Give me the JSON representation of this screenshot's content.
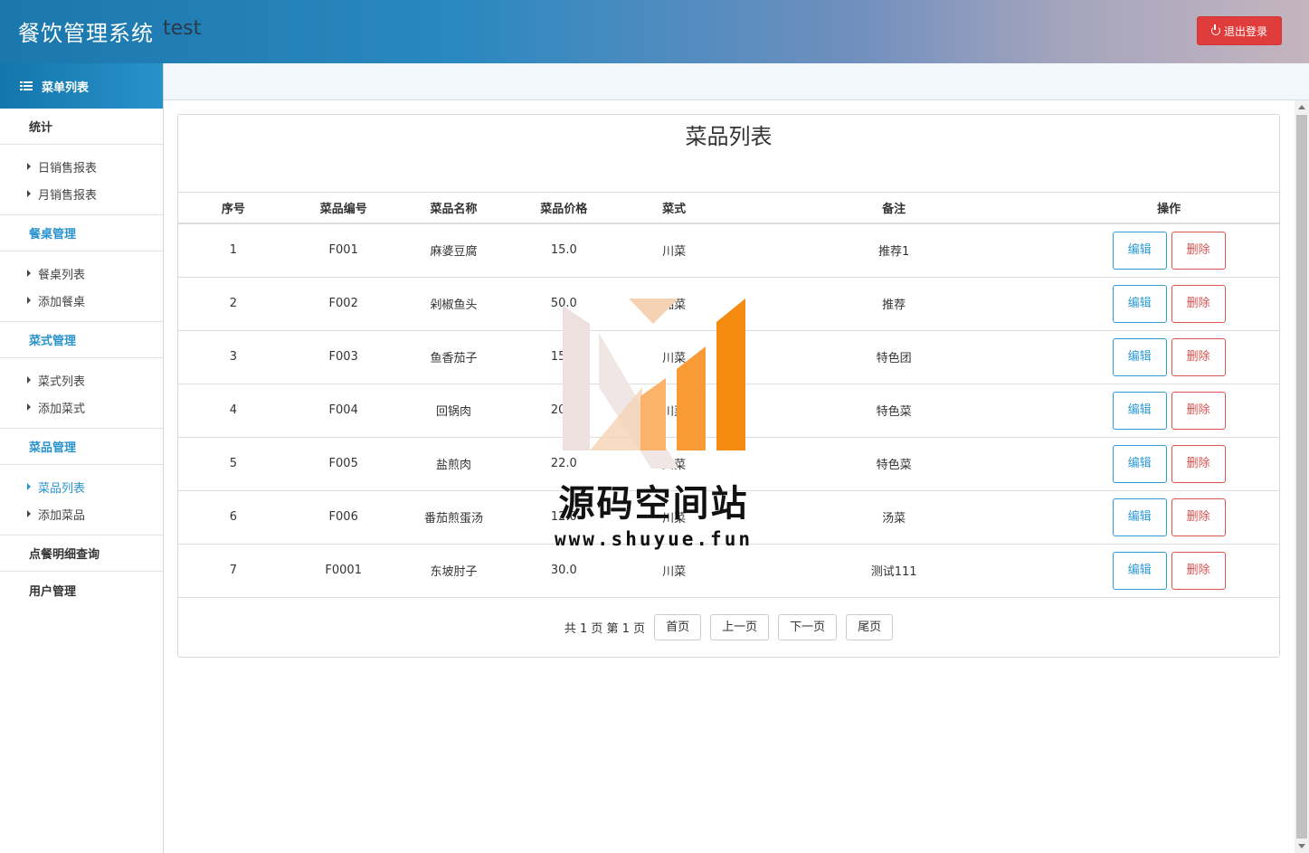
{
  "header": {
    "title": "餐饮管理系统",
    "user": "test",
    "logout_label": "退出登录"
  },
  "sidebar": {
    "title": "菜单列表",
    "groups": [
      {
        "label": "统计",
        "items": [
          "日销售报表",
          "月销售报表"
        ]
      },
      {
        "label": "餐桌管理",
        "items": [
          "餐桌列表",
          "添加餐桌"
        ]
      },
      {
        "label": "菜式管理",
        "items": [
          "菜式列表",
          "添加菜式"
        ]
      },
      {
        "label": "菜品管理",
        "items": [
          "菜品列表",
          "添加菜品"
        ]
      },
      {
        "label": "点餐明细查询",
        "items": []
      },
      {
        "label": "用户管理",
        "items": []
      }
    ],
    "active_item": "菜品列表"
  },
  "main": {
    "title": "菜品列表",
    "columns": [
      "序号",
      "菜品编号",
      "菜品名称",
      "菜品价格",
      "菜式",
      "备注",
      "操作"
    ],
    "rows": [
      {
        "no": "1",
        "code": "F001",
        "name": "麻婆豆腐",
        "price": "15.0",
        "type": "川菜",
        "note": "推荐1"
      },
      {
        "no": "2",
        "code": "F002",
        "name": "剁椒鱼头",
        "price": "50.0",
        "type": "湘菜",
        "note": "推荐"
      },
      {
        "no": "3",
        "code": "F003",
        "name": "鱼香茄子",
        "price": "15.0",
        "type": "川菜",
        "note": "特色团"
      },
      {
        "no": "4",
        "code": "F004",
        "name": "回锅肉",
        "price": "20.0",
        "type": "川菜",
        "note": "特色菜"
      },
      {
        "no": "5",
        "code": "F005",
        "name": "盐煎肉",
        "price": "22.0",
        "type": "川菜",
        "note": "特色菜"
      },
      {
        "no": "6",
        "code": "F006",
        "name": "番茄煎蛋汤",
        "price": "12.0",
        "type": "川菜",
        "note": "汤菜"
      },
      {
        "no": "7",
        "code": "F0001",
        "name": "东坡肘子",
        "price": "30.0",
        "type": "川菜",
        "note": "测试111"
      }
    ],
    "edit_label": "编辑",
    "delete_label": "删除",
    "pager": {
      "info": "共 1 页 第 1 页",
      "first": "首页",
      "prev": "上一页",
      "next": "下一页",
      "last": "尾页"
    }
  },
  "watermark": {
    "text": "源码空间站",
    "url": "www.shuyue.fun"
  },
  "colors": {
    "accent": "#2a93cf",
    "danger": "#e03c3c"
  }
}
